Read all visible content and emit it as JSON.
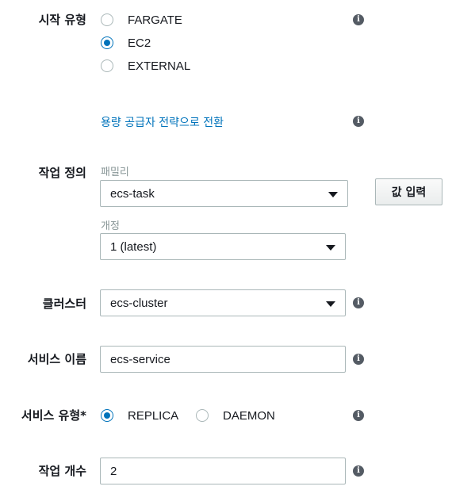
{
  "launch_type": {
    "label": "시작 유형",
    "options": [
      "FARGATE",
      "EC2",
      "EXTERNAL"
    ],
    "selected": "EC2",
    "switch_link": "용량 공급자 전략으로 전환"
  },
  "task_definition": {
    "label": "작업 정의",
    "family_label": "패밀리",
    "family_value": "ecs-task",
    "revision_label": "개정",
    "revision_value": "1 (latest)",
    "enter_value_button": "값 입력"
  },
  "cluster": {
    "label": "클러스터",
    "value": "ecs-cluster"
  },
  "service_name": {
    "label": "서비스 이름",
    "value": "ecs-service"
  },
  "service_type": {
    "label": "서비스 유형*",
    "options": [
      "REPLICA",
      "DAEMON"
    ],
    "selected": "REPLICA"
  },
  "task_count": {
    "label": "작업 개수",
    "value": "2"
  },
  "icons": {
    "info": "info-icon",
    "dropdown": "caret-down-icon"
  },
  "colors": {
    "accent": "#0073bb",
    "border": "#aab7b8",
    "info_icon": "#545b64"
  }
}
